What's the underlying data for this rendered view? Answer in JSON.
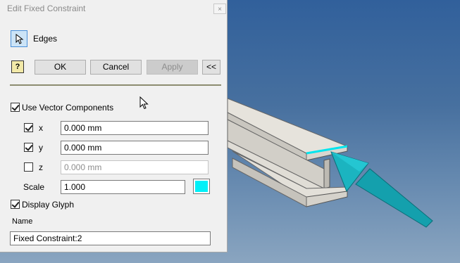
{
  "dialog": {
    "title": "Edit Fixed Constraint",
    "close_glyph": "×",
    "select_label": "Edges",
    "help_icon": "?",
    "buttons": {
      "ok": "OK",
      "cancel": "Cancel",
      "apply": "Apply",
      "collapse": "<<"
    },
    "use_vector_components": {
      "label": "Use Vector Components",
      "checked": true
    },
    "components": [
      {
        "label": "x",
        "value": "0.000 mm",
        "checked": true,
        "enabled": true
      },
      {
        "label": "y",
        "value": "0.000 mm",
        "checked": true,
        "enabled": true
      },
      {
        "label": "z",
        "value": "0.000 mm",
        "checked": false,
        "enabled": false
      }
    ],
    "scale": {
      "label": "Scale",
      "value": "1.000"
    },
    "glyph_color": "#00f0f8",
    "display_glyph": {
      "label": "Display Glyph",
      "checked": true
    },
    "name": {
      "label": "Name",
      "value": "Fixed Constraint:2"
    }
  },
  "viewport": {
    "background_top": "#31609b",
    "background_bottom": "#8aa5c0",
    "part_color": "#dedbd4",
    "highlight_color": "#00e5ee",
    "glyph_arrow_color": "#17a8b4"
  }
}
